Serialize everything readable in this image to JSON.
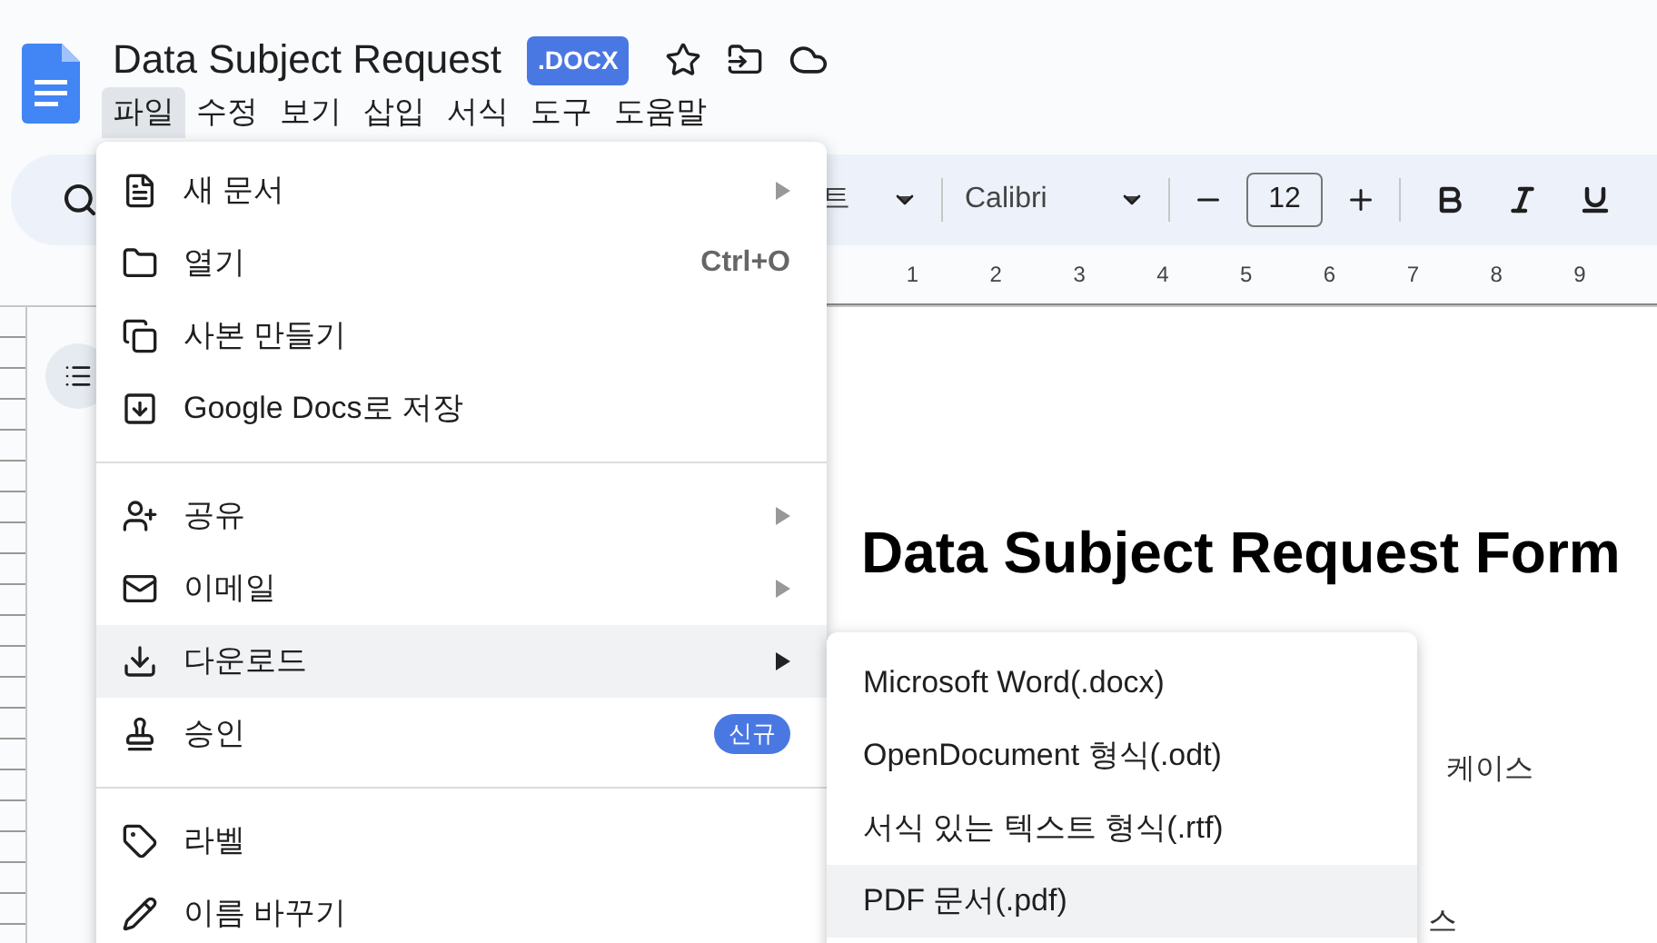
{
  "document_title": "Data Subject Request",
  "file_badge": ".DOCX",
  "menubar": [
    {
      "label": "파일",
      "selected": true
    },
    {
      "label": "수정",
      "selected": false
    },
    {
      "label": "보기",
      "selected": false
    },
    {
      "label": "삽입",
      "selected": false
    },
    {
      "label": "서식",
      "selected": false
    },
    {
      "label": "도구",
      "selected": false
    },
    {
      "label": "도움말",
      "selected": false
    }
  ],
  "toolbar": {
    "style_selector": "트",
    "font": "Calibri",
    "font_size": "12"
  },
  "ruler": [
    "1",
    "2",
    "3",
    "4",
    "5",
    "6",
    "7",
    "8",
    "9"
  ],
  "document": {
    "heading": "Data Subject Request Form",
    "fragments": [
      "케이스",
      "스"
    ]
  },
  "file_menu": [
    {
      "kind": "item",
      "label": "새 문서",
      "submenu": true,
      "highlighted": false
    },
    {
      "kind": "item",
      "label": "열기",
      "shortcut": "Ctrl+O",
      "submenu": false,
      "highlighted": false
    },
    {
      "kind": "item",
      "label": "사본 만들기",
      "submenu": false,
      "highlighted": false
    },
    {
      "kind": "item",
      "label": "Google Docs로 저장",
      "submenu": false,
      "highlighted": false
    },
    {
      "kind": "divider"
    },
    {
      "kind": "item",
      "label": "공유",
      "submenu": true,
      "highlighted": false
    },
    {
      "kind": "item",
      "label": "이메일",
      "submenu": true,
      "highlighted": false
    },
    {
      "kind": "item",
      "label": "다운로드",
      "submenu": true,
      "highlighted": true
    },
    {
      "kind": "item",
      "label": "승인",
      "badge": "신규",
      "submenu": false,
      "highlighted": false
    },
    {
      "kind": "divider"
    },
    {
      "kind": "item",
      "label": "라벨",
      "submenu": false,
      "highlighted": false
    },
    {
      "kind": "item",
      "label": "이름 바꾸기",
      "submenu": false,
      "highlighted": false
    }
  ],
  "download_menu": [
    {
      "label": "Microsoft Word(.docx)",
      "highlighted": false
    },
    {
      "label": "OpenDocument 형식(.odt)",
      "highlighted": false
    },
    {
      "label": "서식 있는 텍스트 형식(.rtf)",
      "highlighted": false
    },
    {
      "label": "PDF 문서(.pdf)",
      "highlighted": true
    }
  ]
}
